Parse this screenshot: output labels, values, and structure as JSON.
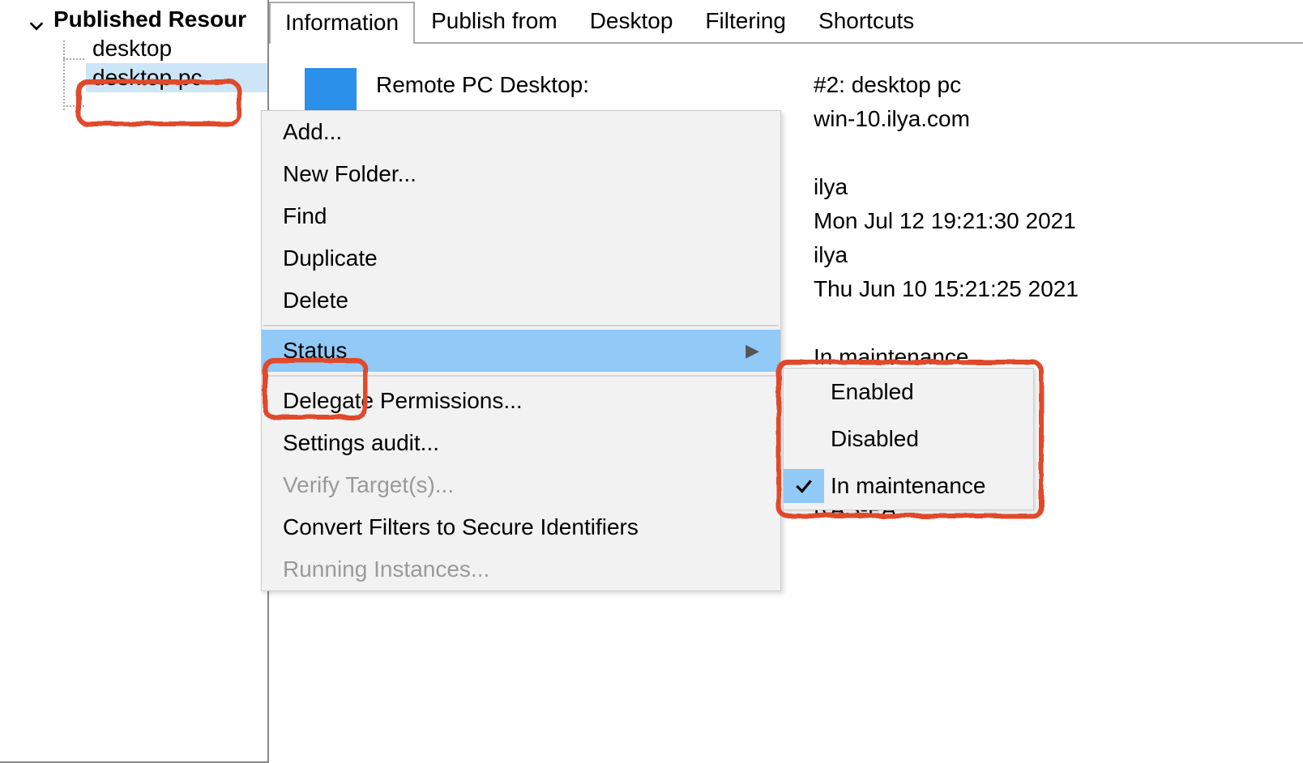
{
  "tree": {
    "root_label": "Published Resour",
    "items": [
      {
        "label": "desktop"
      },
      {
        "label": "desktop pc",
        "selected": true
      }
    ]
  },
  "tabs": [
    {
      "label": "Information",
      "active": true
    },
    {
      "label": "Publish from"
    },
    {
      "label": "Desktop"
    },
    {
      "label": "Filtering"
    },
    {
      "label": "Shortcuts"
    }
  ],
  "info": {
    "heading": "Remote PC Desktop:",
    "id_line": "#2: desktop pc",
    "host": "win-10.ilya.com",
    "user1": "ilya",
    "date1": "Mon Jul 12 19:21:30 2021",
    "user2": "ilya",
    "date2": "Thu Jun 10 15:21:25 2021",
    "status": "In maintenance",
    "agent": "RAS-PA"
  },
  "context_menu": {
    "items": [
      {
        "label": "Add...",
        "enabled": true
      },
      {
        "label": "New Folder...",
        "enabled": true
      },
      {
        "label": "Find",
        "enabled": true
      },
      {
        "label": "Duplicate",
        "enabled": true
      },
      {
        "label": "Delete",
        "enabled": true
      },
      {
        "sep": true
      },
      {
        "label": "Status",
        "enabled": true,
        "highlight": true,
        "submenu": true
      },
      {
        "sep": true
      },
      {
        "label": "Delegate Permissions...",
        "enabled": true
      },
      {
        "label": "Settings audit...",
        "enabled": true
      },
      {
        "label": "Verify Target(s)...",
        "enabled": false
      },
      {
        "label": "Convert Filters to Secure Identifiers",
        "enabled": true
      },
      {
        "label": "Running Instances...",
        "enabled": false
      }
    ]
  },
  "status_submenu": {
    "items": [
      {
        "label": "Enabled",
        "checked": false
      },
      {
        "label": "Disabled",
        "checked": false
      },
      {
        "label": "In maintenance",
        "checked": true
      }
    ]
  }
}
